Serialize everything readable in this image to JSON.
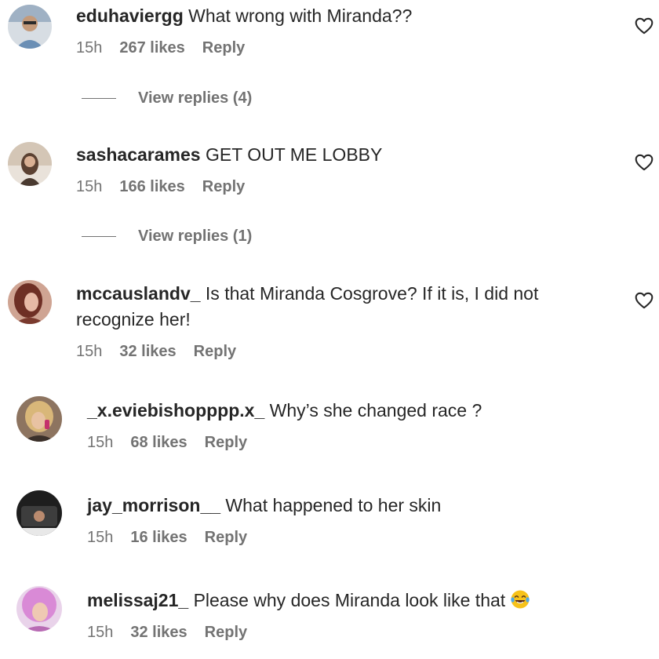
{
  "comments": [
    {
      "username": "eduhaviergg",
      "text": "What wrong with Miranda??",
      "time": "15h",
      "likes": "267 likes",
      "reply": "Reply",
      "view_replies": "View replies (4)",
      "avatar_color": "#6b8fb5"
    },
    {
      "username": "sashacarames",
      "text": "GET OUT ME LOBBY",
      "time": "15h",
      "likes": "166 likes",
      "reply": "Reply",
      "view_replies": "View replies (1)",
      "avatar_color": "#c9a98c"
    },
    {
      "username": "mccauslandv_",
      "text": "Is that Miranda Cosgrove? If it is, I did not",
      "text_cont": "recognize her!",
      "time": "15h",
      "likes": "32 likes",
      "reply": "Reply",
      "avatar_color": "#a0584a"
    },
    {
      "username": "_x.eviebishopppp.x_",
      "text": "Why’s she changed race ?",
      "time": "15h",
      "likes": "68 likes",
      "reply": "Reply",
      "avatar_color": "#b08a5d"
    },
    {
      "username": "jay_morrison__",
      "text": "What happened to her skin",
      "time": "15h",
      "likes": "16 likes",
      "reply": "Reply",
      "avatar_color": "#3d3d3d"
    },
    {
      "username": "melissaj21_",
      "text": "Please why does Miranda look like that",
      "time": "15h",
      "likes": "32 likes",
      "reply": "Reply",
      "avatar_color": "#d98ad6",
      "emoji": "laughing-tears-emoji"
    }
  ],
  "icons": {
    "like": "heart-outline-icon"
  }
}
